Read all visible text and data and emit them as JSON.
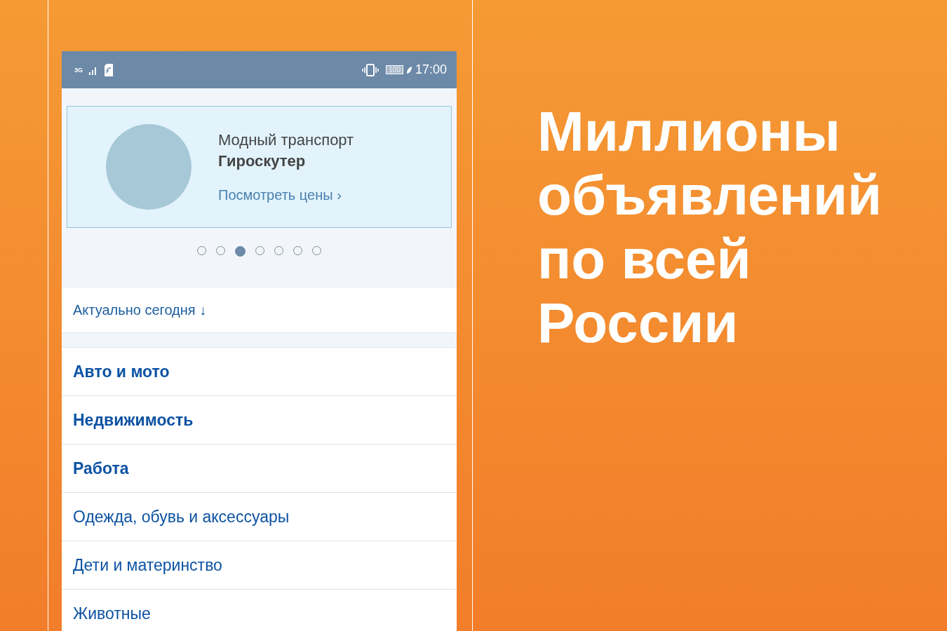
{
  "status_bar": {
    "network": "3G",
    "battery": "100",
    "time": "17:00"
  },
  "banner": {
    "subtitle": "Модный транспорт",
    "title": "Гироскутер",
    "link": "Посмотреть цены",
    "link_arrow": "›"
  },
  "carousel_dots": [
    {
      "selected": false
    },
    {
      "selected": false
    },
    {
      "selected": true
    },
    {
      "selected": false
    },
    {
      "selected": false
    },
    {
      "selected": false
    },
    {
      "selected": false
    }
  ],
  "today": {
    "label": "Актуально сегодня",
    "arrow": "↓"
  },
  "categories": [
    {
      "label": "Авто и мото",
      "bold": true
    },
    {
      "label": "Недвижимость",
      "bold": true
    },
    {
      "label": "Работа",
      "bold": true
    },
    {
      "label": "Одежда, обувь и аксессуары",
      "bold": false
    },
    {
      "label": "Дети и материнство",
      "bold": false
    },
    {
      "label": "Животные",
      "bold": false
    }
  ],
  "headline": [
    "Миллионы",
    "объявлений",
    "по всей",
    "России"
  ]
}
